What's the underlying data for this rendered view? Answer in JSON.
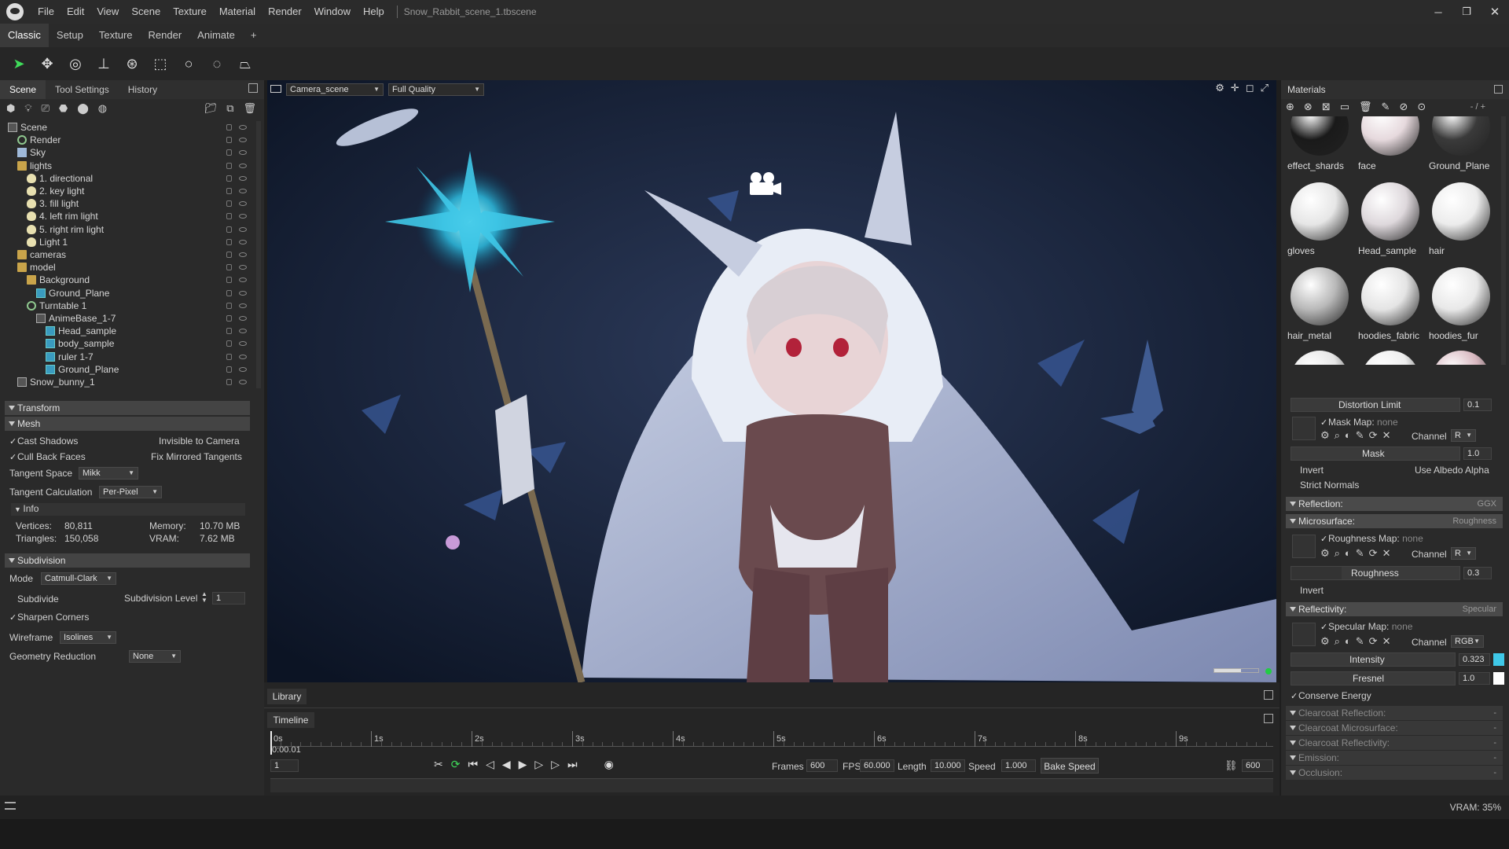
{
  "titlebar": {
    "menu": [
      "File",
      "Edit",
      "View",
      "Scene",
      "Texture",
      "Material",
      "Render",
      "Window",
      "Help"
    ],
    "doc_title": "Snow_Rabbit_scene_1.tbscene",
    "controls": {
      "minimize": "─",
      "maximize": "❐",
      "close": "✕"
    }
  },
  "workspace_tabs": [
    "Classic",
    "Setup",
    "Texture",
    "Render",
    "Animate",
    "+"
  ],
  "left_panel": {
    "tabs": [
      "Scene",
      "Tool Settings",
      "History"
    ],
    "tree": [
      {
        "label": "Scene",
        "depth": 0,
        "icon": "node"
      },
      {
        "label": "Render",
        "depth": 1,
        "icon": "gear"
      },
      {
        "label": "Sky",
        "depth": 1,
        "icon": "sky"
      },
      {
        "label": "lights",
        "depth": 1,
        "icon": "folder"
      },
      {
        "label": "1. directional",
        "depth": 2,
        "icon": "light"
      },
      {
        "label": "2. key light",
        "depth": 2,
        "icon": "light"
      },
      {
        "label": "3. fill light",
        "depth": 2,
        "icon": "light"
      },
      {
        "label": "4. left rim light",
        "depth": 2,
        "icon": "light"
      },
      {
        "label": "5. right rim light",
        "depth": 2,
        "icon": "light"
      },
      {
        "label": "Light 1",
        "depth": 2,
        "icon": "light"
      },
      {
        "label": "cameras",
        "depth": 1,
        "icon": "folder"
      },
      {
        "label": "model",
        "depth": 1,
        "icon": "folder"
      },
      {
        "label": "Background",
        "depth": 2,
        "icon": "folder"
      },
      {
        "label": "Ground_Plane",
        "depth": 3,
        "icon": "mesh"
      },
      {
        "label": "Turntable 1",
        "depth": 2,
        "icon": "gear"
      },
      {
        "label": "AnimeBase_1-7",
        "depth": 3,
        "icon": "node"
      },
      {
        "label": "Head_sample",
        "depth": 4,
        "icon": "mesh"
      },
      {
        "label": "body_sample",
        "depth": 4,
        "icon": "mesh"
      },
      {
        "label": "ruler 1-7",
        "depth": 4,
        "icon": "mesh"
      },
      {
        "label": "Ground_Plane",
        "depth": 4,
        "icon": "mesh"
      },
      {
        "label": "Snow_bunny_1",
        "depth": 1,
        "icon": "node"
      }
    ],
    "transform_header": "Transform",
    "mesh": {
      "header": "Mesh",
      "cast_shadows": "Cast Shadows",
      "invisible_to_camera": "Invisible to Camera",
      "cull_back_faces": "Cull Back Faces",
      "fix_mirrored_tangents": "Fix Mirrored Tangents",
      "tangent_space_label": "Tangent Space",
      "tangent_space_value": "Mikk",
      "tangent_calc_label": "Tangent Calculation",
      "tangent_calc_value": "Per-Pixel",
      "info_header": "Info",
      "vertices_label": "Vertices:",
      "vertices_value": "80,811",
      "triangles_label": "Triangles:",
      "triangles_value": "150,058",
      "memory_label": "Memory:",
      "memory_value": "10.70 MB",
      "vram_label": "VRAM:",
      "vram_value": "7.62 MB"
    },
    "subdivision": {
      "header": "Subdivision",
      "mode_label": "Mode",
      "mode_value": "Catmull-Clark",
      "subdivide": "Subdivide",
      "level_label": "Subdivision Level",
      "level_value": "1",
      "sharpen": "Sharpen Corners",
      "wireframe_label": "Wireframe",
      "wireframe_value": "Isolines",
      "geo_label": "Geometry Reduction",
      "geo_value": "None"
    }
  },
  "viewport": {
    "camera": "Camera_scene",
    "quality": "Full Quality"
  },
  "bottom": {
    "library_tab": "Library",
    "timeline_tab": "Timeline",
    "time_labels": [
      "0s",
      "1s",
      "2s",
      "3s",
      "4s",
      "5s",
      "6s",
      "7s",
      "8s",
      "9s"
    ],
    "current_time": "0:00.01",
    "frame_field": "1",
    "frames_label": "Frames",
    "frames_value": "600",
    "fps_label": "FPS",
    "fps_value": "60.000",
    "length_label": "Length",
    "length_value": "10.000",
    "speed_label": "Speed",
    "speed_value": "1.000",
    "bake_speed": "Bake Speed",
    "end_frame": "600"
  },
  "right_panel": {
    "title": "Materials",
    "zoom_label": "- / +",
    "materials": [
      {
        "name": "effect_shards",
        "color": "#1a1a1a"
      },
      {
        "name": "face",
        "color": "#e6d9dd"
      },
      {
        "name": "Ground_Plane",
        "color": "#3a3a3a"
      },
      {
        "name": "gloves",
        "color": "#e6e6e6"
      },
      {
        "name": "Head_sample",
        "color": "#ded8dc"
      },
      {
        "name": "hair",
        "color": "#ececec"
      },
      {
        "name": "hair_metal",
        "color": "#b8b8b8"
      },
      {
        "name": "hoodies_fabric",
        "color": "#e4e4e4"
      },
      {
        "name": "hoodies_fur",
        "color": "#e8e8e8"
      }
    ],
    "distortion_limit_label": "Distortion Limit",
    "distortion_limit_value": "0.1",
    "mask_map_label": "Mask Map:",
    "mask_map_value": "none",
    "channel_label": "Channel",
    "channel_r": "R",
    "mask_label": "Mask",
    "mask_value": "1.0",
    "invert": "Invert",
    "use_albedo_alpha": "Use Albedo Alpha",
    "strict_normals": "Strict Normals",
    "reflection": {
      "label": "Reflection:",
      "value": "GGX"
    },
    "microsurface": {
      "label": "Microsurface:",
      "value": "Roughness"
    },
    "roughness_map_label": "Roughness Map:",
    "roughness_map_value": "none",
    "roughness_label": "Roughness",
    "roughness_value": "0.3",
    "invert2": "Invert",
    "reflectivity": {
      "label": "Reflectivity:",
      "value": "Specular"
    },
    "specular_map_label": "Specular Map:",
    "specular_map_value": "none",
    "channel_rgb": "RGB",
    "intensity_label": "Intensity",
    "intensity_value": "0.323",
    "fresnel_label": "Fresnel",
    "fresnel_value": "1.0",
    "conserve_energy": "Conserve Energy",
    "clearcoat_reflection": "Clearcoat Reflection:",
    "clearcoat_microsurface": "Clearcoat Microsurface:",
    "clearcoat_reflectivity": "Clearcoat Reflectivity:",
    "emission": "Emission:",
    "occlusion": "Occlusion:",
    "dash": "-"
  },
  "status": {
    "vram": "VRAM: 35%"
  },
  "colors": {
    "accent_cyan": "#3fc8e8",
    "selection_green": "#22cc44",
    "panel_bg": "#2a2a2a",
    "header_bg": "#444444"
  }
}
